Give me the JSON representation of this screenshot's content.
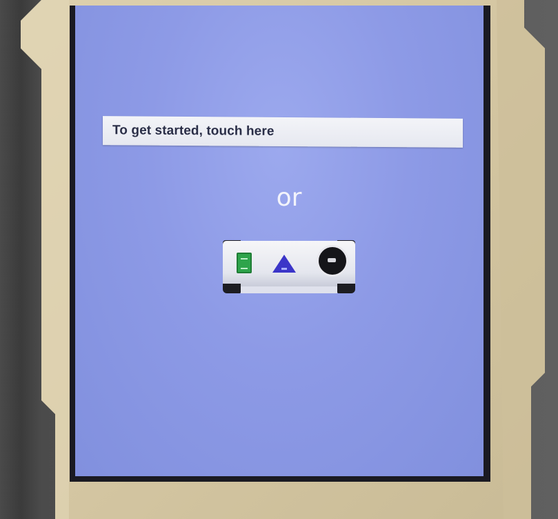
{
  "prompt": {
    "label": "To get started, touch here"
  },
  "separator": {
    "text": "or"
  },
  "controller": {
    "buttons": [
      "green-button-icon",
      "blue-triangle-button-icon",
      "rotary-knob-icon"
    ]
  },
  "colors": {
    "screen_background": "#8d9ae6",
    "prompt_bar": "#eceef4",
    "prompt_text": "#2a2e47",
    "separator_text": "#f2f3fb",
    "bezel": "#d7c9a6",
    "green_button": "#2ea44b",
    "triangle_button": "#3b35c8",
    "knob": "#151519"
  }
}
